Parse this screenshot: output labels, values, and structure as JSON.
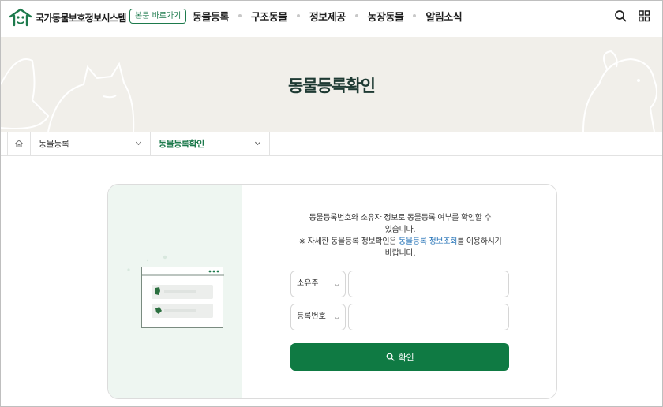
{
  "header": {
    "site_name": "국가동물보호정보시스템",
    "skip_label": "본문 바로가기",
    "nav": [
      "동물등록",
      "구조동물",
      "정보제공",
      "농장동물",
      "알림소식"
    ]
  },
  "hero": {
    "title": "동물등록확인"
  },
  "breadcrumb": {
    "level1": "동물등록",
    "level2": "동물등록확인"
  },
  "form": {
    "description_line1": "동물등록번호와 소유자 정보로 동물등록 여부를 확인할 수",
    "description_line2": "있습니다.",
    "description_line3_prefix": "※ 자세한 동물등록 정보확인은 ",
    "description_line3_link": "동물등록 정보조회",
    "description_line3_suffix": "를 이용하시기",
    "description_line4": "바랍니다.",
    "field1_select": "소유주",
    "field2_select": "등록번호",
    "field1_value": "",
    "field2_value": "",
    "submit_label": "확인"
  },
  "colors": {
    "brand_green": "#0f7a43",
    "link_blue": "#1f6fb5",
    "hero_bg": "#f1efea"
  }
}
